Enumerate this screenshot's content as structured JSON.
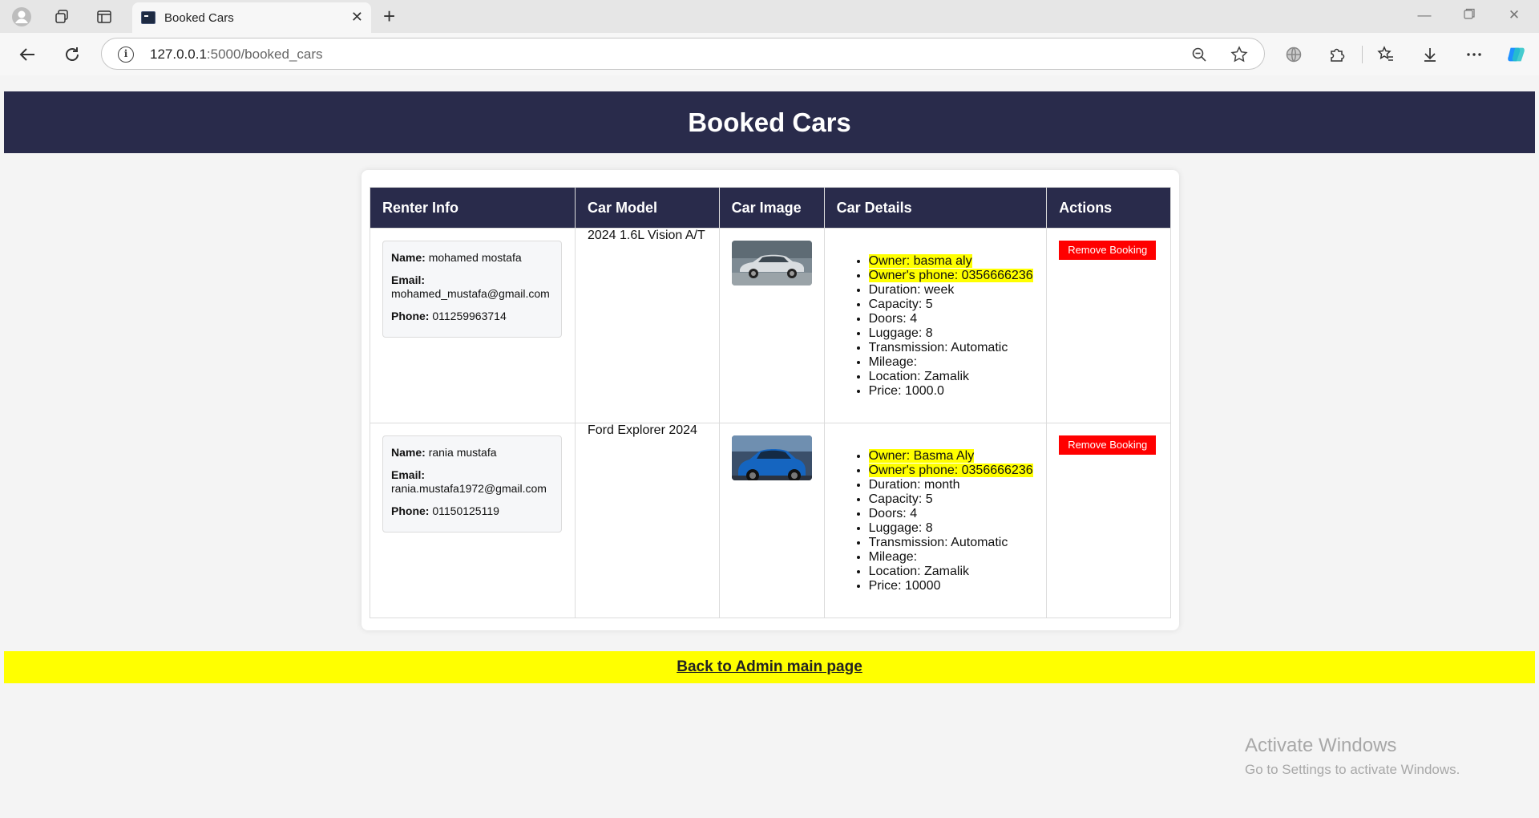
{
  "browser": {
    "tab_title": "Booked Cars",
    "url_host": "127.0.0.1",
    "url_path": ":5000/booked_cars"
  },
  "page": {
    "title": "Booked Cars",
    "columns": [
      "Renter Info",
      "Car Model",
      "Car Image",
      "Car Details",
      "Actions"
    ],
    "labels": {
      "name": "Name:",
      "email": "Email:",
      "phone": "Phone:"
    },
    "bookings": [
      {
        "renter": {
          "name": "mohamed mostafa",
          "email": "mohamed_mustafa@gmail.com",
          "phone": "011259963714"
        },
        "model": "2024 1.6L Vision A/T",
        "image_color": "silver",
        "details": [
          "Owner: basma aly",
          "Owner's phone: 0356666236",
          "Duration: week",
          "Capacity: 5",
          "Doors: 4",
          "Luggage: 8",
          "Transmission: Automatic",
          "Mileage:",
          "Location: Zamalik",
          "Price: 1000.0"
        ],
        "action": "Remove Booking"
      },
      {
        "renter": {
          "name": "rania mustafa",
          "email": "rania.mustafa1972@gmail.com",
          "phone": "01150125119"
        },
        "model": "Ford Explorer 2024",
        "image_color": "blue",
        "details": [
          "Owner: Basma Aly",
          "Owner's phone: 0356666236",
          "Duration: month",
          "Capacity: 5",
          "Doors: 4",
          "Luggage: 8",
          "Transmission: Automatic",
          "Mileage:",
          "Location: Zamalik",
          "Price: 10000"
        ],
        "action": "Remove Booking"
      }
    ],
    "back_link": "Back to Admin main page"
  },
  "os_overlay": {
    "title": "Activate Windows",
    "subtitle": "Go to Settings to activate Windows."
  },
  "colors": {
    "header_bg": "#292b4b",
    "highlight": "#ffff00",
    "remove_button": "#ff0000"
  }
}
